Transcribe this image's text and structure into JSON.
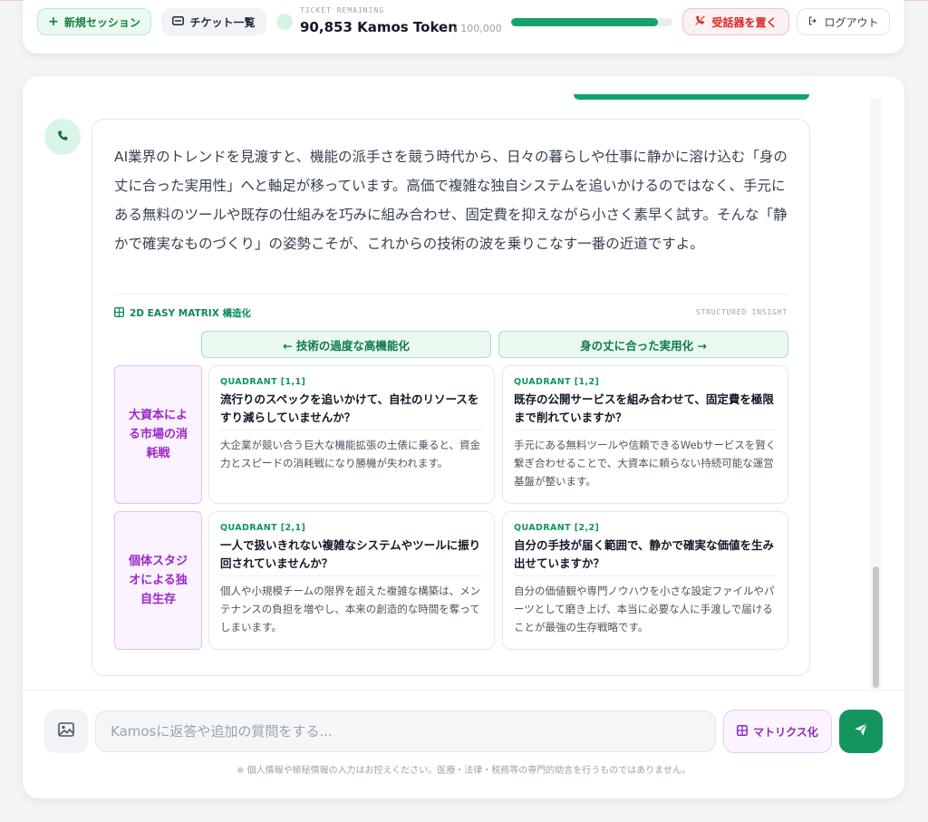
{
  "header": {
    "new_session_label": "新規セッション",
    "tickets_label": "チケット一覧",
    "ticket_caption": "TICKET REMAINING",
    "ticket_amount": "90,853 Kamos Token",
    "ticket_max": "/ 100,000",
    "ticket_progress_fraction": 0.9085,
    "hangup_label": "受話器を置く",
    "logout_label": "ログアウト"
  },
  "colors": {
    "accent_green": "#16a36b",
    "accent_purple": "#9b27c9",
    "danger_red": "#dc2626"
  },
  "message": {
    "avatar_icon": "phone-icon",
    "text": "AI業界のトレンドを見渡すと、機能の派手さを競う時代から、日々の暮らしや仕事に静かに溶け込む「身の丈に合った実用性」へと軸足が移っています。高価で複雑な独自システムを追いかけるのではなく、手元にある無料のツールや既存の仕組みを巧みに組み合わせ、固定費を抑えながら小さく素早く試す。そんな「静かで確実なものづくり」の姿勢こそが、これからの技術の波を乗りこなす一番の近道ですよ。"
  },
  "matrix": {
    "title": "2D EASY MATRIX 構造化",
    "tag": "STRUCTURED INSIGHT",
    "columns": [
      "← 技術の過度な高機能化",
      "身の丈に合った実用化 →"
    ],
    "rows": [
      "大資本による市場の消耗戦",
      "個体スタジオによる独自生存"
    ],
    "quadrants": [
      {
        "label": "QUADRANT [1,1]",
        "question": "流行りのスペックを追いかけて、自社のリソースをすり減らしていませんか？",
        "body": "大企業が競い合う巨大な機能拡張の土俵に乗ると、資金力とスピードの消耗戦になり勝機が失われます。"
      },
      {
        "label": "QUADRANT [1,2]",
        "question": "既存の公開サービスを組み合わせて、固定費を極限まで削れていますか？",
        "body": "手元にある無料ツールや信頼できるWebサービスを賢く繋ぎ合わせることで、大資本に頼らない持続可能な運営基盤が整います。"
      },
      {
        "label": "QUADRANT [2,1]",
        "question": "一人で扱いきれない複雑なシステムやツールに振り回されていませんか？",
        "body": "個人や小規模チームの限界を超えた複雑な構築は、メンテナンスの負担を増やし、本来の創造的な時間を奪ってしまいます。"
      },
      {
        "label": "QUADRANT [2,2]",
        "question": "自分の手技が届く範囲で、静かで確実な価値を生み出せていますか？",
        "body": "自分の価値観や専門ノウハウを小さな設定ファイルやパーツとして磨き上げ、本当に必要な人に手渡しで届けることが最強の生存戦略です。"
      }
    ]
  },
  "composer": {
    "placeholder": "Kamosに返答や追加の質問をする...",
    "matrix_button_label": "マトリクス化",
    "disclaimer": "※ 個人情報や極秘情報の入力はお控えください。医療・法律・税務等の専門的助言を行うものではありません。"
  }
}
